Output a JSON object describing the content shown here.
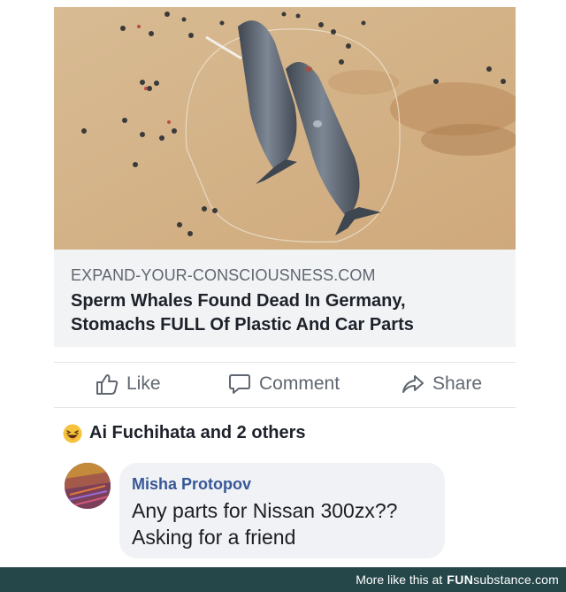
{
  "post": {
    "image_alt": "aerial view of two sperm whales on a beach",
    "link": {
      "domain": "EXPAND-YOUR-CONSCIOUSNESS.COM",
      "title_line1": "Sperm Whales Found Dead In Germany,",
      "title_line2": "Stomachs FULL Of Plastic And Car Parts"
    },
    "actions": {
      "like": "Like",
      "comment": "Comment",
      "share": "Share"
    },
    "reactions": {
      "text": "Ai Fuchihata and 2 others",
      "icon": "laughing-emoji-icon"
    }
  },
  "comment": {
    "author": "Misha Protopov",
    "text_line1": "Any parts for Nissan 300zx??",
    "text_line2": "Asking for a friend"
  },
  "footer": {
    "prefix": "More like this at",
    "brand_bold": "FUN",
    "brand_rest": "substance.com"
  },
  "colors": {
    "sand": "#d4b48a",
    "link_card_bg": "#f2f3f5",
    "action_text": "#606770",
    "commenter_name": "#385898",
    "footer_bg": "#26474a"
  }
}
